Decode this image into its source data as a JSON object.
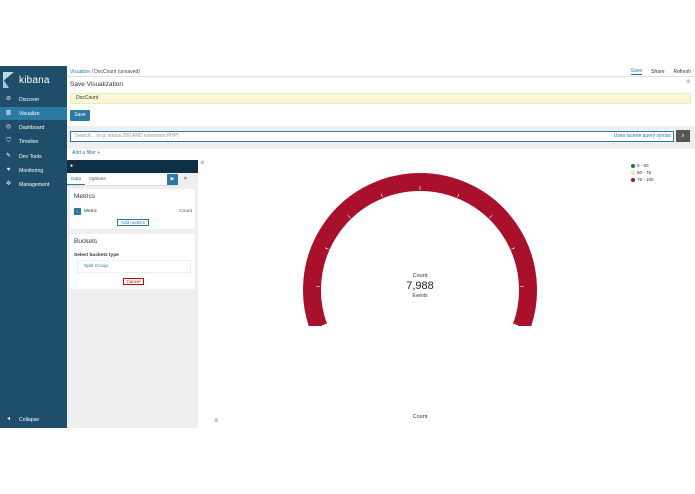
{
  "app": {
    "brand": "kibana"
  },
  "sidebar": {
    "items": [
      {
        "label": "Discover",
        "icon": "compass-icon",
        "active": false
      },
      {
        "label": "Visualize",
        "icon": "bar-chart-icon",
        "active": true
      },
      {
        "label": "Dashboard",
        "icon": "dashboard-icon",
        "active": false
      },
      {
        "label": "Timelion",
        "icon": "shield-icon",
        "active": false
      },
      {
        "label": "Dev Tools",
        "icon": "wrench-icon",
        "active": false
      },
      {
        "label": "Monitoring",
        "icon": "heart-icon",
        "active": false
      },
      {
        "label": "Management",
        "icon": "gear-icon",
        "active": false
      }
    ],
    "collapse_label": "Collapse"
  },
  "topbar": {
    "breadcrumb_link": "Visualize",
    "breadcrumb_sep": "/",
    "breadcrumb_current": "DocCount (unsaved)",
    "save_label": "Save",
    "share_label": "Share",
    "refresh_label": "Refresh"
  },
  "save_panel": {
    "title": "Save Visualization",
    "name_value": "DocCount",
    "button_label": "Save"
  },
  "search": {
    "placeholder": "Search... (e.g. status:200 AND extension:PHP)",
    "syntax_link": "Uses lucene query syntax"
  },
  "filter": {
    "add_label": "Add a filter +"
  },
  "editor": {
    "tabs": [
      "Data",
      "Options"
    ],
    "metrics": {
      "title": "Metrics",
      "row_label": "Metric",
      "row_value": "Count",
      "add_label": "Add metrics"
    },
    "buckets": {
      "title": "Buckets",
      "select_label": "Select buckets type",
      "split_group": "Split Group",
      "cancel_label": "Cancel"
    }
  },
  "colors": {
    "sidebar": "#1f4e6b",
    "accent": "#2b7aa3",
    "gauge_fill": "#a8102b"
  },
  "chart_data": {
    "type": "gauge",
    "label": "Count",
    "value": 7988,
    "value_display": "7,988",
    "sublabel": "Events",
    "x_title": "Count",
    "legend": [
      {
        "range": "0 - 50",
        "color": "#1a7d3c"
      },
      {
        "range": "50 - 75",
        "color": "#f1e8a0"
      },
      {
        "range": "75 - 100",
        "color": "#a8102b"
      }
    ],
    "active_range": "75 - 100"
  }
}
